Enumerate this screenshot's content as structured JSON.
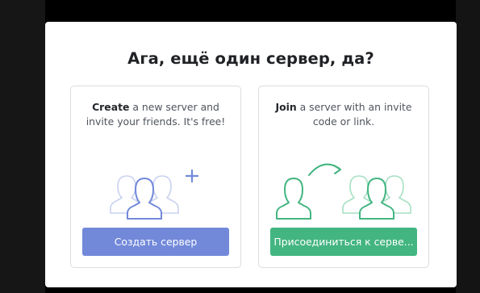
{
  "modal": {
    "title": "Ага, ещё один сервер, да?"
  },
  "create_card": {
    "bold": "Create",
    "line1_rest": " a new server and",
    "line2": "invite your friends. It's free!",
    "button_label": "Создать сервер",
    "icon_color": "#7289da",
    "icon": "users-plus-icon"
  },
  "join_card": {
    "bold": "Join",
    "line1_rest": " a server with an invite",
    "line2": "code or link.",
    "button_label": "Присоединиться к серве...",
    "icon_color": "#43b581",
    "icon": "user-arrow-group-icon"
  },
  "colors": {
    "create_accent": "#7289da",
    "join_accent": "#43b581",
    "modal_bg": "#ffffff",
    "overlay": "#000000"
  }
}
